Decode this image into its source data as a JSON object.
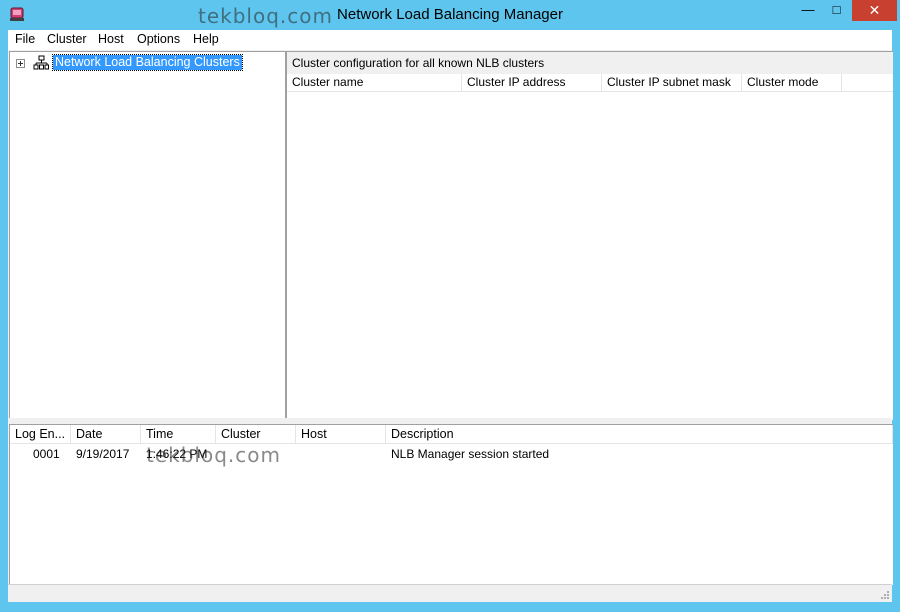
{
  "window": {
    "title": "Network Load Balancing Manager",
    "watermark": "tekbloq.com",
    "controls": {
      "minimize": "—",
      "maximize": "□",
      "close": "✕"
    }
  },
  "menubar": {
    "items": [
      "File",
      "Cluster",
      "Host",
      "Options",
      "Help"
    ]
  },
  "tree": {
    "root_label": "Network Load Balancing Clusters",
    "expander": "plus-box-icon",
    "icon": "network-clusters-icon"
  },
  "clusters_panel": {
    "caption": "Cluster configuration for all known NLB clusters",
    "columns": [
      "Cluster name",
      "Cluster IP address",
      "Cluster IP subnet mask",
      "Cluster mode"
    ],
    "rows": []
  },
  "log_panel": {
    "columns": [
      "Log En...",
      "Date",
      "Time",
      "Cluster",
      "Host",
      "Description"
    ],
    "rows": [
      {
        "entry": "0001",
        "date": "9/19/2017",
        "time": "1:46:22 PM",
        "cluster": "",
        "host": "",
        "description": "NLB Manager session started"
      }
    ]
  },
  "colors": {
    "frame": "#5ec6ee",
    "close_button": "#c8402f",
    "selection": "#3399ff"
  }
}
